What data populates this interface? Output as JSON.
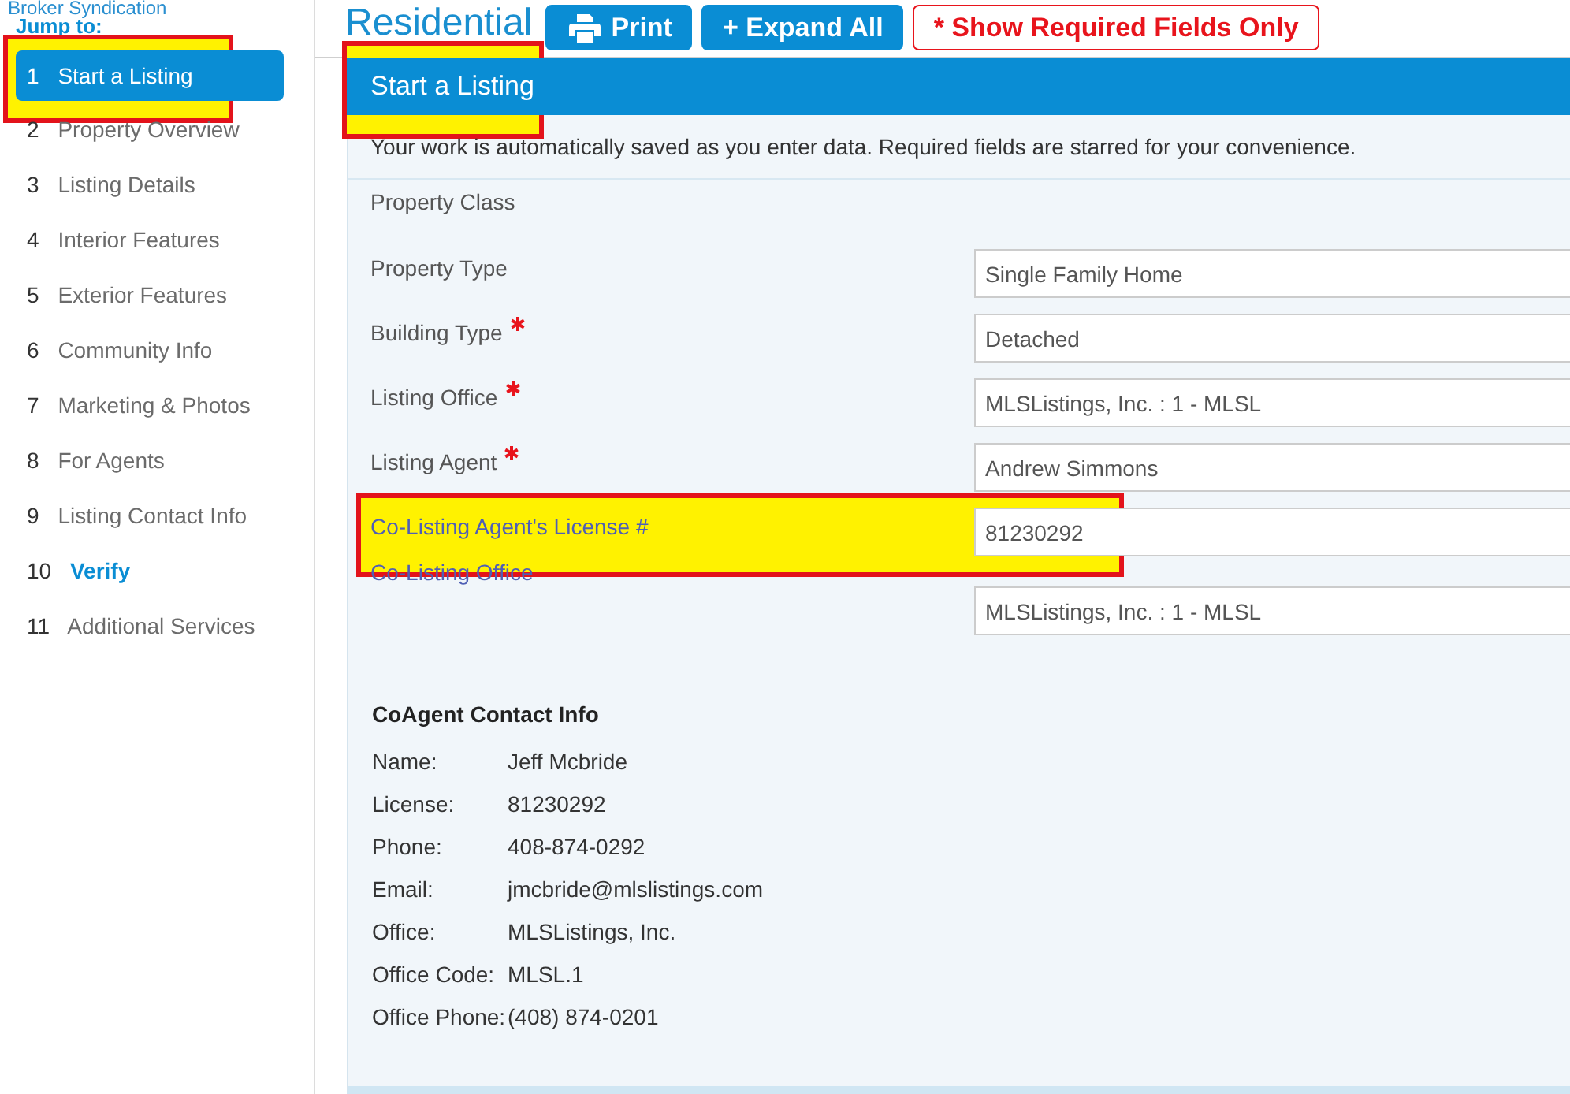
{
  "sidebar": {
    "header": "Broker Syndication",
    "jump_label": "Jump to:",
    "items": [
      {
        "number": "1",
        "label": "Start a Listing",
        "selected": true,
        "emphasized": false,
        "annotated": true
      },
      {
        "number": "2",
        "label": "Property Overview",
        "selected": false,
        "emphasized": false,
        "annotated": false
      },
      {
        "number": "3",
        "label": "Listing Details",
        "selected": false,
        "emphasized": false,
        "annotated": false
      },
      {
        "number": "4",
        "label": "Interior Features",
        "selected": false,
        "emphasized": false,
        "annotated": false
      },
      {
        "number": "5",
        "label": "Exterior Features",
        "selected": false,
        "emphasized": false,
        "annotated": false
      },
      {
        "number": "6",
        "label": "Community Info",
        "selected": false,
        "emphasized": false,
        "annotated": false
      },
      {
        "number": "7",
        "label": "Marketing & Photos",
        "selected": false,
        "emphasized": false,
        "annotated": false
      },
      {
        "number": "8",
        "label": "For Agents",
        "selected": false,
        "emphasized": false,
        "annotated": false
      },
      {
        "number": "9",
        "label": "Listing Contact Info",
        "selected": false,
        "emphasized": false,
        "annotated": false
      },
      {
        "number": "10",
        "label": "Verify",
        "selected": false,
        "emphasized": true,
        "annotated": false
      },
      {
        "number": "11",
        "label": "Additional Services",
        "selected": false,
        "emphasized": false,
        "annotated": false
      }
    ]
  },
  "header": {
    "title": "Residential",
    "buttons": [
      {
        "kind": "print",
        "label": "Print"
      },
      {
        "kind": "primary",
        "label": "+ Expand All"
      },
      {
        "kind": "outline",
        "label": "* Show Required Fields Only"
      }
    ]
  },
  "section": {
    "title": "Start a Listing",
    "annotated": true,
    "notice": "Your work is automatically saved as you enter data. Required fields are starred for your convenience.",
    "fields": [
      {
        "kind": "plain",
        "label": "Property Class",
        "required": false,
        "annotated": false
      },
      {
        "kind": "input",
        "label": "Property Type",
        "value": "Single Family Home",
        "required": false,
        "annotated": false
      },
      {
        "kind": "input",
        "label": "Building Type",
        "value": "Detached",
        "required": true,
        "annotated": false
      },
      {
        "kind": "input",
        "label": "Listing Office",
        "value": "MLSListings, Inc. : 1 - MLSL",
        "required": true,
        "annotated": false
      },
      {
        "kind": "input",
        "label": "Listing Agent",
        "value": "Andrew Simmons",
        "required": true,
        "annotated": false
      },
      {
        "kind": "linked",
        "label": "Co-Listing Agent's License #",
        "value": "81230292",
        "required": false,
        "annotated": true
      },
      {
        "kind": "stacked",
        "label": "Co-Listing Office",
        "value": "MLSListings, Inc. : 1 - MLSL",
        "required": false,
        "annotated": false
      }
    ],
    "contact": {
      "title": "CoAgent Contact Info",
      "rows": [
        {
          "label": "Name:",
          "value": "Jeff Mcbride"
        },
        {
          "label": "License:",
          "value": "81230292"
        },
        {
          "label": "Phone:",
          "value": "408-874-0292"
        },
        {
          "label": "Email:",
          "value": "jmcbride@mlslistings.com"
        },
        {
          "label": "Office:",
          "value": "MLSListings, Inc."
        },
        {
          "label": "Office Code:",
          "value": "MLSL.1"
        },
        {
          "label": "Office Phone:",
          "value": "(408) 874-0201"
        }
      ]
    }
  }
}
